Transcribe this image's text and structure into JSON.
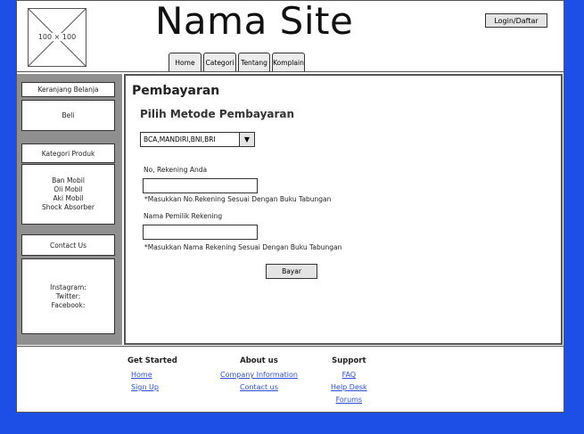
{
  "header": {
    "logo_placeholder": "100 × 100",
    "site_title": "Nama Site",
    "login_label": "Login/Daftar",
    "tabs": [
      {
        "label": "Home"
      },
      {
        "label": "Categori"
      },
      {
        "label": "Tentang"
      },
      {
        "label": "Komplain"
      }
    ]
  },
  "sidebar": {
    "cart_title": "Keranjang Belanja",
    "cart_item": "Beli",
    "category_title": "Kategori Produk",
    "categories": [
      "Ban Mobil",
      "Oli Mobil",
      "Aki Mobil",
      "Shock Absorber"
    ],
    "contact_title": "Contact Us",
    "social": [
      "Instagram:",
      "Twitter:",
      "Facebook:"
    ]
  },
  "main": {
    "page_title": "Pembayaran",
    "section_title": "Pilih Metode Pembayaran",
    "payment_select_value": "BCA,MANDIRI,BNI,BRI",
    "account_number_label": "No, Rekening Anda",
    "account_number_value": "",
    "account_number_note": "*Masukkan No.Rekening Sesuai Dengan Buku Tabungan",
    "account_name_label": "Nama Pemilik Rekening",
    "account_name_value": "",
    "account_name_note": "*Masukkan Nama Rekening Sesuai Dengan Buku Tabungan",
    "submit_label": "Bayar"
  },
  "footer": {
    "get_started": {
      "title": "Get Started",
      "links": [
        "Home",
        "Sign Up"
      ]
    },
    "about": {
      "title": "About us",
      "links": [
        "Company Information",
        "Contact us"
      ]
    },
    "support": {
      "title": "Support",
      "links": [
        "FAQ",
        "Help Desk",
        "Forums"
      ]
    }
  },
  "colors": {
    "background": "#1d4fe6",
    "link": "#2e4fd6",
    "sidebar": "#8f8f8f"
  }
}
